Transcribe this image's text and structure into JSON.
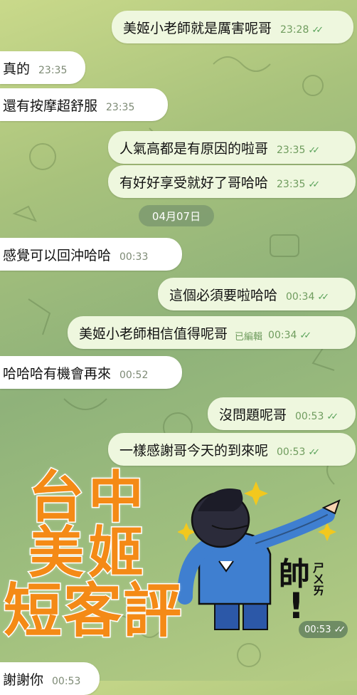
{
  "messages": [
    {
      "text": "美姬小老師就是厲害呢哥",
      "time": "23:28",
      "dir": "out"
    },
    {
      "text": "真的",
      "time": "23:35",
      "dir": "in"
    },
    {
      "text": "還有按摩超舒服",
      "time": "23:35",
      "dir": "in"
    },
    {
      "text": "人氣高都是有原因的啦哥",
      "time": "23:35",
      "dir": "out"
    },
    {
      "text": "有好好享受就好了哥哈哈",
      "time": "23:35",
      "dir": "out"
    },
    {
      "text": "感覺可以回沖哈哈",
      "time": "00:33",
      "dir": "in"
    },
    {
      "text": "這個必須要啦哈哈",
      "time": "00:34",
      "dir": "out"
    },
    {
      "text": "美姬小老師相信值得呢哥",
      "time": "00:34",
      "dir": "out",
      "edited": "已編輯"
    },
    {
      "text": "哈哈哈有機會再來",
      "time": "00:52",
      "dir": "in"
    },
    {
      "text": "沒問題呢哥",
      "time": "00:53",
      "dir": "out"
    },
    {
      "text": "一樣感謝哥今天的到來呢",
      "time": "00:53",
      "dir": "out"
    },
    {
      "text": "謝謝你",
      "time": "00:53",
      "dir": "in"
    }
  ],
  "date_separator": "04月07日",
  "overlay": {
    "line1": "台中",
    "line2": "美姬",
    "line3": "短客評"
  },
  "sticker": {
    "shuai": "帥",
    "bopomofo": "ㄕㄨㄞ",
    "exclaim": "!",
    "time": "00:53"
  },
  "colors": {
    "outgoing_bubble": "#eef7de",
    "incoming_bubble": "#ffffff",
    "overlay_text": "#f48a16",
    "check": "#5aa35b"
  }
}
